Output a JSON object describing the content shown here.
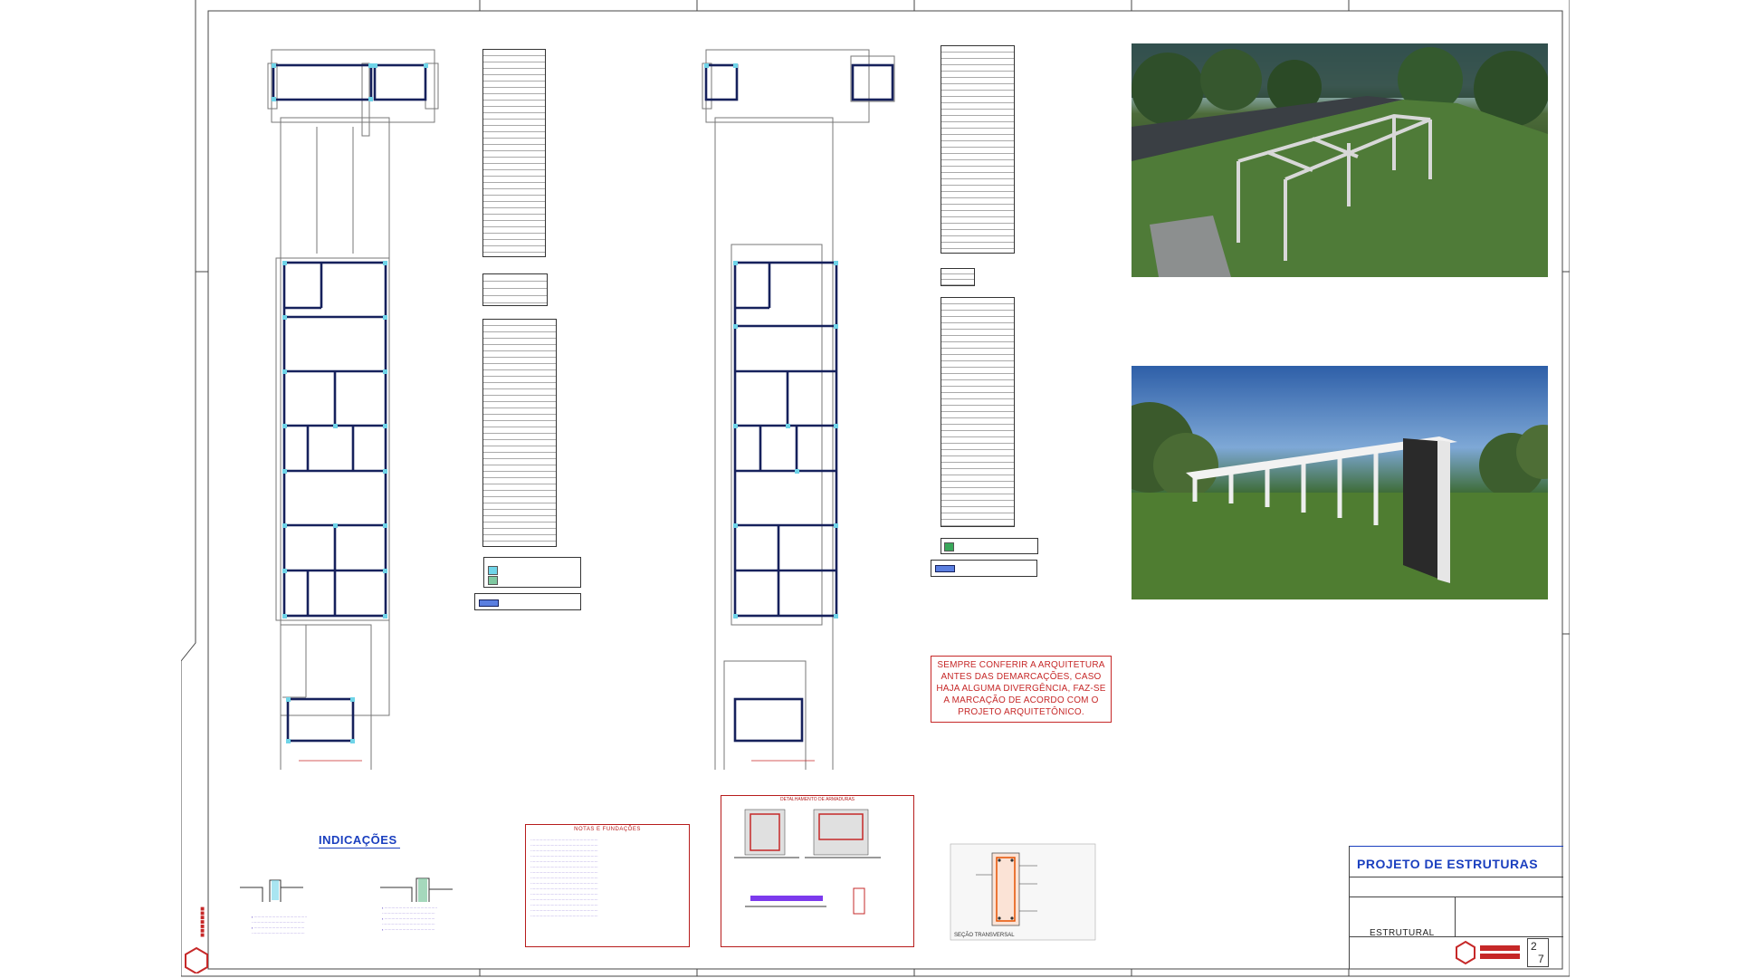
{
  "sheet": {
    "warning_text": [
      "SEMPRE CONFERIR A ARQUITETURA",
      "ANTES DAS DEMARCAÇÕES, CASO",
      "HAJA ALGUMA DIVERGÊNCIA, FAZ-SE",
      "A MARCAÇÃO DE ACORDO COM O",
      "PROJETO ARQUITETÔNICO."
    ],
    "indications_title": "INDICAÇÕES",
    "notes_title": "NOTAS E FUNDAÇÕES",
    "detail_title": "DETALHAMENTO DE ARMADURAS",
    "detail_bottom_label": "SEÇÃO TRANSVERSAL",
    "title_block": {
      "project_title": "PROJETO DE ESTRUTURAS",
      "discipline": "ESTRUTURAL",
      "sheet_number": "2",
      "sheet_total": "7"
    },
    "colors": {
      "beam": "#16215c",
      "pillar": "#6fd4e8",
      "warning": "#c62828",
      "title_blue": "#1a3fbf"
    },
    "icons": [
      "company-logo-icon",
      "render-3d-image"
    ]
  }
}
